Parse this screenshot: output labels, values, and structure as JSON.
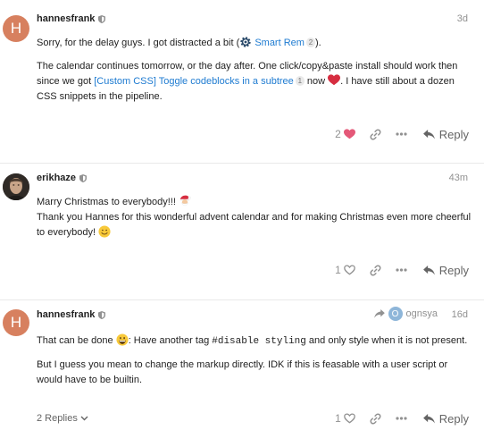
{
  "posts": [
    {
      "username": "hannesfrank",
      "avatar_letter": "H",
      "timestamp": "3d",
      "para1_before": "Sorry, for the delay guys. I got distracted a bit (",
      "para1_link": "Smart Rem",
      "para1_link_count": "2",
      "para1_after": ").",
      "para2_before": "The calendar continues tomorrow, or the day after. One click/copy&paste install should work then since we got ",
      "para2_link": "[Custom CSS] Toggle codeblocks in a subtree",
      "para2_link_count": "1",
      "para2_mid": " now ",
      "para2_after": ". I have still about a dozen CSS snippets in the pipeline.",
      "like_count": "2",
      "reply_label": "Reply"
    },
    {
      "username": "erikhaze",
      "timestamp": "43m",
      "line1": "Marry Christmas to everybody!!! ",
      "line2": "Thank you Hannes for this wonderful advent calendar and for making Christmas even more cheerful to everybody! ",
      "like_count": "1",
      "reply_label": "Reply"
    },
    {
      "username": "hannesfrank",
      "avatar_letter": "H",
      "timestamp": "16d",
      "reply_to_letter": "O",
      "reply_to_user": "ognsya",
      "para1_before": "That can be done ",
      "para1_mid": ": Have another tag ",
      "para1_code": "#disable styling",
      "para1_after": " and only style when it is not present.",
      "para2": "But I guess you mean to change the markup directly. IDK if this is feasable with a user script or would have to be builtin.",
      "replies_label": "2 Replies",
      "like_count": "1",
      "reply_label": "Reply"
    }
  ],
  "colors": {
    "link": "#1e7bd1",
    "heart_liked": "#e45878",
    "avatar_letter_bg": "#d7805f",
    "muted": "#919191"
  }
}
